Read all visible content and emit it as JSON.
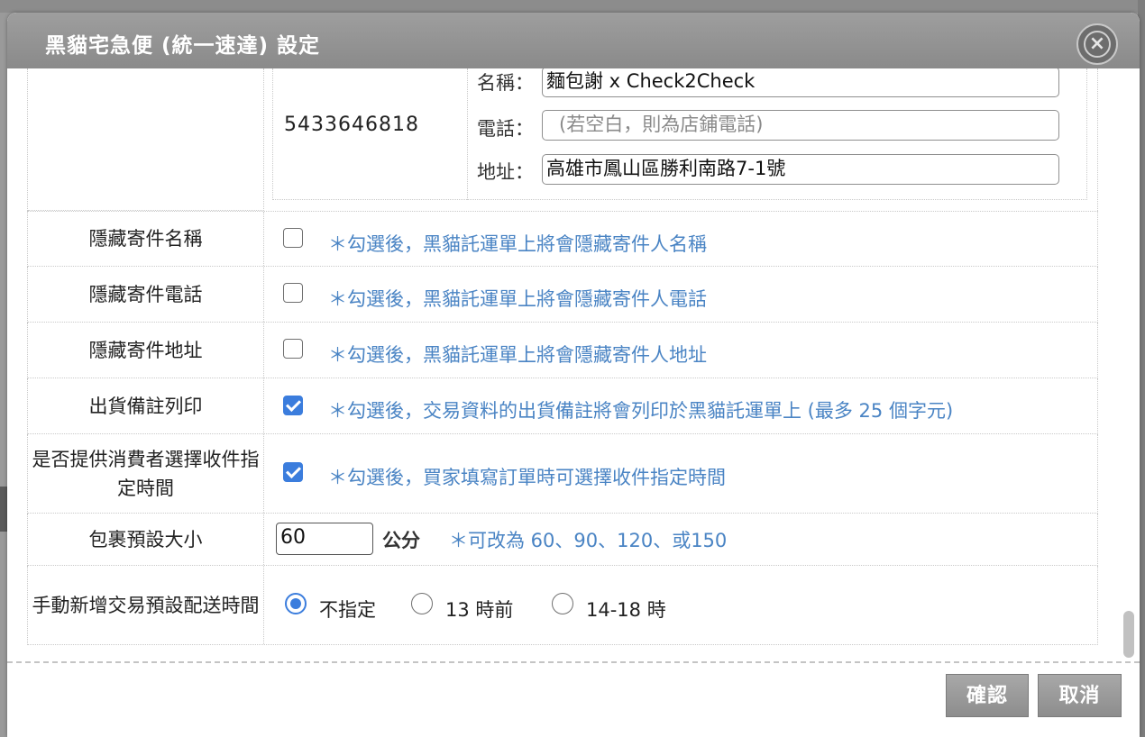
{
  "dialog": {
    "title": "黑貓宅急便 (統一速達) 設定",
    "close_icon": "close-circle-icon"
  },
  "sender": {
    "account_number": "5433646818",
    "name_label": "名稱：",
    "name_value": "麵包謝 x Check2Check",
    "phone_label": "電話：",
    "phone_placeholder": "(若空白，則為店鋪電話)",
    "address_label": "地址：",
    "address_value": "高雄市鳳山區勝利南路7-1號"
  },
  "rows": {
    "hide_name": {
      "label": "隱藏寄件名稱",
      "checked": false,
      "note": "＊勾選後，黑貓託運單上將會隱藏寄件人名稱"
    },
    "hide_phone": {
      "label": "隱藏寄件電話",
      "checked": false,
      "note": "＊勾選後，黑貓託運單上將會隱藏寄件人電話"
    },
    "hide_address": {
      "label": "隱藏寄件地址",
      "checked": false,
      "note": "＊勾選後，黑貓託運單上將會隱藏寄件人地址"
    },
    "print_note": {
      "label": "出貨備註列印",
      "checked": true,
      "note": "＊勾選後，交易資料的出貨備註將會列印於黑貓託運單上 (最多 25 個字元)"
    },
    "delivery_time_choice": {
      "label": "是否提供消費者選擇收件指定時間",
      "checked": true,
      "note": "＊勾選後，買家填寫訂單時可選擇收件指定時間"
    },
    "package_size": {
      "label": "包裹預設大小",
      "value": "60",
      "unit": "公分",
      "note": "＊可改為 60、90、120、或150"
    },
    "default_time": {
      "label": "手動新增交易預設配送時間",
      "options": [
        "不指定",
        "13 時前",
        "14-18 時"
      ],
      "selected": "不指定"
    }
  },
  "footer": {
    "confirm_label": "確認",
    "cancel_label": "取消"
  },
  "colors": {
    "accent": "#3b7ddd",
    "note_text": "#4a84c4",
    "titlebar": "#8f8f8f"
  }
}
